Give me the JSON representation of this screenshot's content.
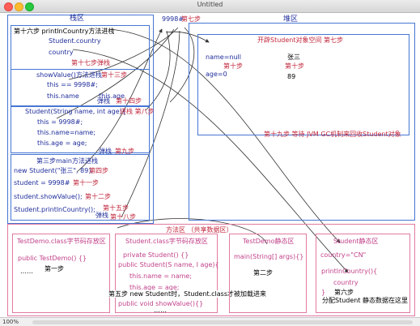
{
  "window": {
    "title": "Untitled",
    "zoom": "100%"
  },
  "stack": {
    "title": "栈区",
    "frame_println": {
      "label": "第十六步 printlnCountry方法进栈",
      "line1": "Student.country",
      "line2": "country",
      "pop": "第十七步弹栈"
    },
    "frame_show": {
      "label": "showValue()方法进栈",
      "step": "第十三步",
      "line1": "this == 9998#;",
      "line2": "this.name",
      "line3": "this.age",
      "pop": "弹栈",
      "pop_step": "第十四步"
    },
    "frame_ctor": {
      "label": "Student(String name, int age){",
      "label_step": "进栈 第八步",
      "line1": "this = 9998#;",
      "line2": "this.name=name;",
      "line3": "this.age = age;",
      "pop": "弹栈",
      "pop_step": "第九步"
    },
    "frame_main": {
      "label": "第三步main方法进栈",
      "line1": "new Student(\"张三\", 89);",
      "line1_step": "第四步",
      "line2": "student = 9998#",
      "line2_step": "第十一步",
      "line3": "student.showValue();",
      "line3_step": "第十二步",
      "line4": "Student.printlnCountry();",
      "line4_step": "第十五步",
      "pop": "弹栈",
      "pop_step": "第十八步"
    }
  },
  "heap": {
    "title": "堆区",
    "address": "9998#",
    "address_step": "第七步",
    "alloc": "开辟Student对象空间 第七步",
    "name_field": "name=null",
    "name_value": "张三",
    "name_step": "第十步",
    "age_field": "age=0",
    "age_step": "第十步",
    "age_value": "89",
    "gc": "第十九步 等待 JVM GC机制来回收Student对象"
  },
  "method_area": {
    "title": "方法区 （共享数据区）",
    "testdemo_bytecode": {
      "title": "TestDemo.class字节码存放区",
      "line1": "public TestDemo() {}",
      "line2": "……",
      "step": "第一步"
    },
    "student_bytecode": {
      "title": "Student.class字节码存放区",
      "line1": "private Student() {}",
      "line2": "public Student(S name, I age){",
      "line3": "this.name = name;",
      "line4": "this.age = age;",
      "line5": "public void showValue(){}",
      "line6": "……",
      "note": "第五步 new Student时，Student.class才被加载进来"
    },
    "testdemo_static": {
      "title": "TestDemo静态区",
      "line1": "main(String[] args){}",
      "step": "第二步"
    },
    "student_static": {
      "title": "Student静态区",
      "line1": "country=\"CN\"",
      "line2": "printlnCountry(){",
      "line3": "country",
      "line4": "}",
      "step": "第六步",
      "note": "分配Student 静态数据在这里"
    }
  }
}
